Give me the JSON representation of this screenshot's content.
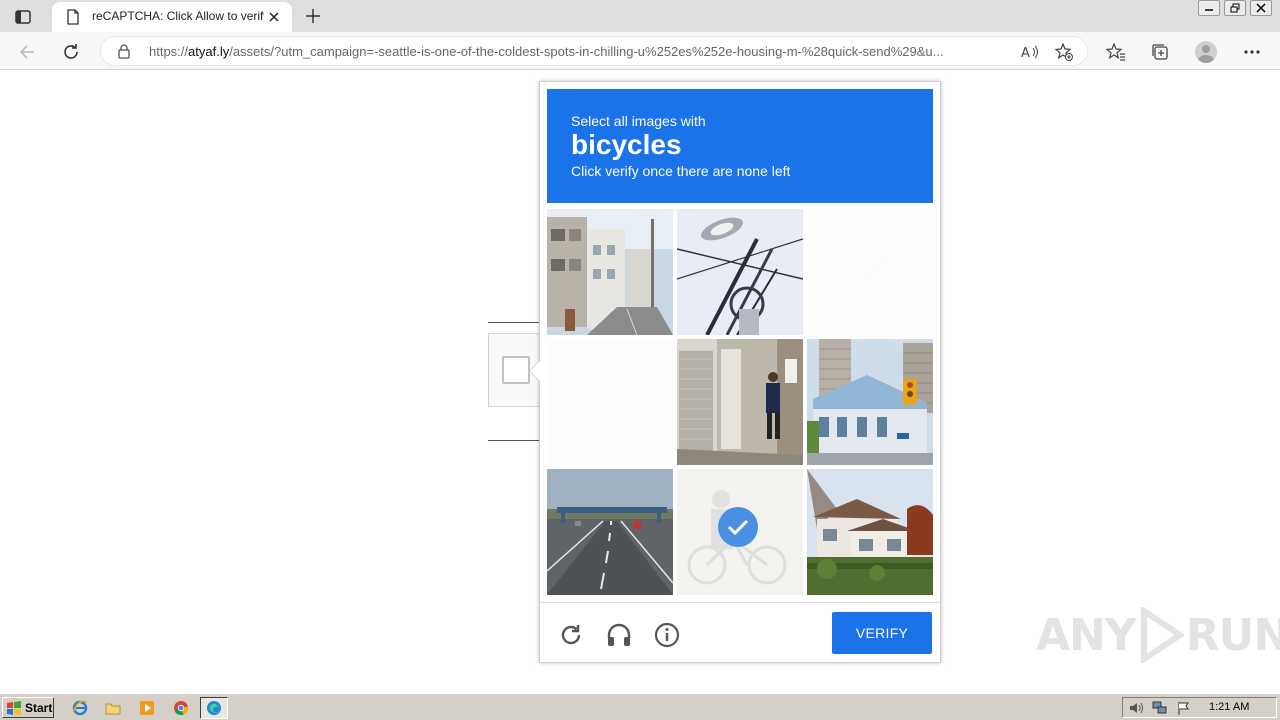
{
  "browser": {
    "tab_title": "reCAPTCHA: Click Allow to verify",
    "url_prefix": "https://",
    "url_host": "atyaf.ly",
    "url_path": "/assets/?utm_campaign=-seattle-is-one-of-the-coldest-spots-in-chilling-u%252es%252e-housing-m-%28quick-send%29&u..."
  },
  "captcha": {
    "instruction": "Select all images with",
    "target": "bicycles",
    "hint": "Click verify once there are none left",
    "verify_label": "VERIFY",
    "tiles": [
      {
        "state": "image",
        "subject": "narrow street with houses"
      },
      {
        "state": "image",
        "subject": "street lamp and wires"
      },
      {
        "state": "faded",
        "subject": "blank"
      },
      {
        "state": "faded",
        "subject": "blank"
      },
      {
        "state": "image",
        "subject": "person walking by building"
      },
      {
        "state": "image",
        "subject": "towers and traffic light"
      },
      {
        "state": "image",
        "subject": "highway with bridge"
      },
      {
        "state": "selected",
        "subject": "person with bicycle"
      },
      {
        "state": "image",
        "subject": "house with trees"
      }
    ]
  },
  "watermark": {
    "left": "ANY",
    "right": "RUN"
  },
  "taskbar": {
    "start_label": "Start",
    "clock": "1:21 AM"
  },
  "colors": {
    "accent": "#1a73e8",
    "taskbar": "#d4d0c8"
  }
}
